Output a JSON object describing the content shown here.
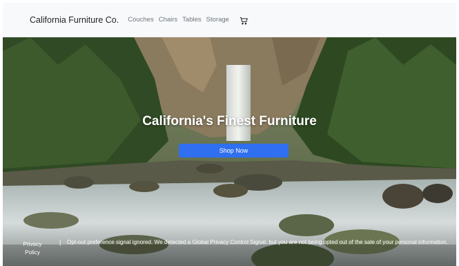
{
  "navbar": {
    "brand": "California Furniture Co.",
    "links": [
      "Couches",
      "Chairs",
      "Tables",
      "Storage"
    ],
    "cart_icon": "cart-icon"
  },
  "hero": {
    "title": "California's Finest Furniture",
    "button_label": "Shop Now",
    "background": "forest-waterfall-river-image"
  },
  "privacy": {
    "link_label": "Privacy Policy",
    "separator": "|",
    "message": "Opt-out preference signal ignored. We detected a Global Privacy Control Signal, but you are not being opted out of the sale of your personal information."
  },
  "colors": {
    "navbar_bg": "#f8f9fa",
    "button": "#2f6ff0"
  }
}
